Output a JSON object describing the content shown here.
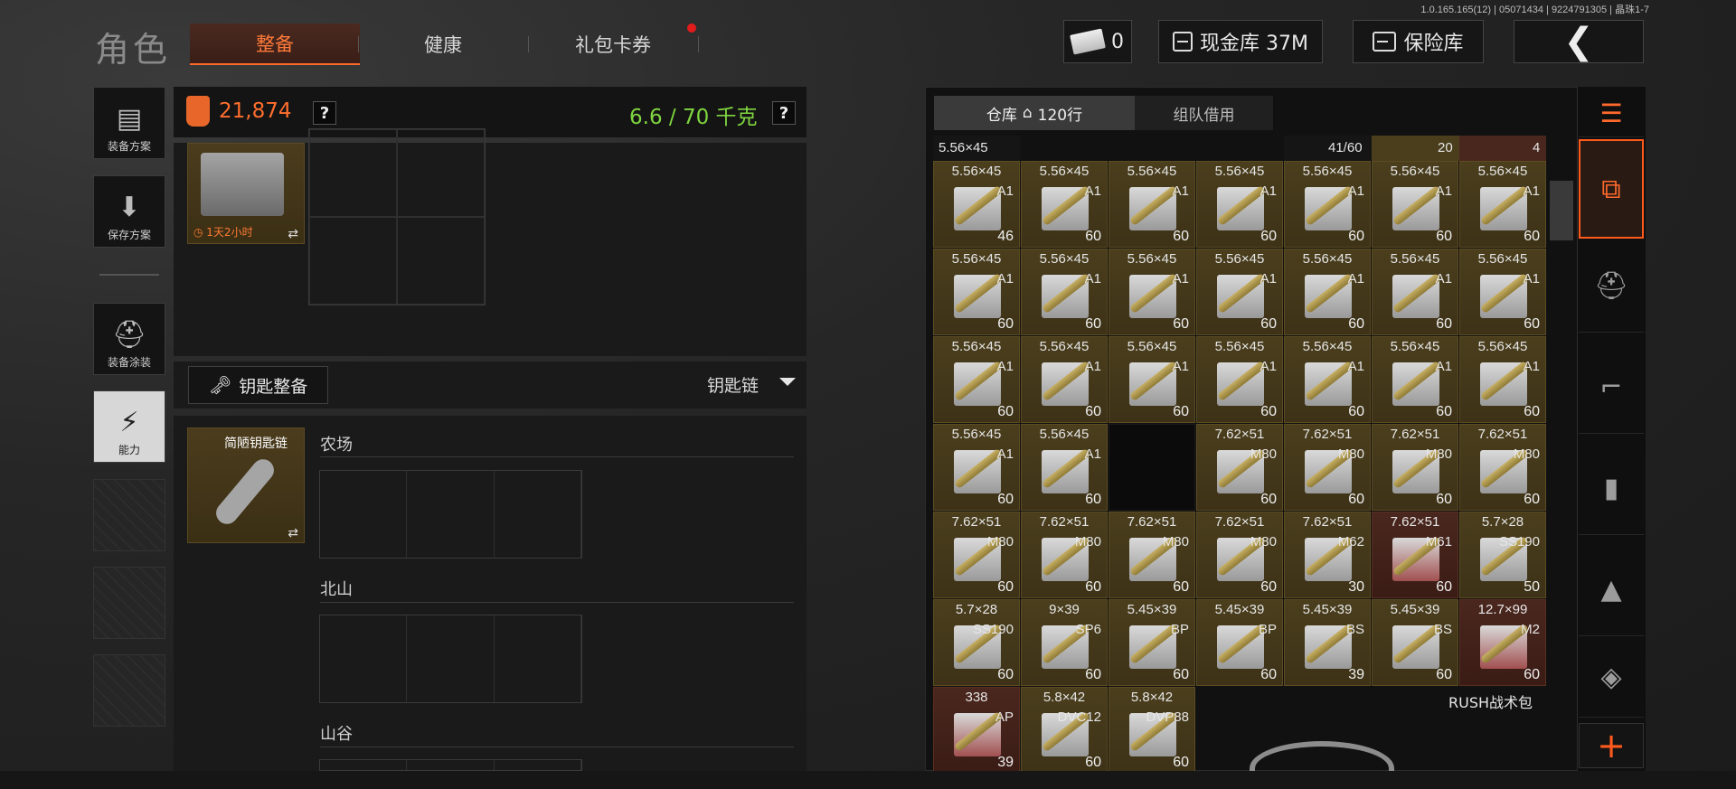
{
  "version": "1.0.165.165(12) | 05071434 | 9224791305 | 晶珠1-7",
  "page_title": "角色",
  "tabs": [
    {
      "label": "整备"
    },
    {
      "label": "健康"
    },
    {
      "label": "礼包卡券"
    }
  ],
  "top": {
    "money": "0",
    "cash": "现金库 37M",
    "safe": "保险库"
  },
  "rail": [
    {
      "label": "装备方案",
      "icon": "vest-icon"
    },
    {
      "label": "保存方案",
      "icon": "download-icon"
    },
    {
      "label": "装备涂装",
      "icon": "helmet-icon"
    },
    {
      "label": "能力",
      "icon": "ability-icon"
    }
  ],
  "stats": {
    "armor_value": "21,874",
    "weight": "6.6 / 70 千克",
    "help": "?"
  },
  "case_item": {
    "timer": "1天2小时",
    "swap": "⇄"
  },
  "keys": {
    "button_label": "钥匙整备",
    "dropdown_label": "钥匙链",
    "item_name": "简陋钥匙链",
    "swap": "⇄",
    "zones": [
      "农场",
      "北山",
      "山谷"
    ]
  },
  "inventory": {
    "tab_warehouse": "仓库",
    "rows": "120行",
    "tab_team": "组队借用",
    "top_strip": [
      {
        "text": "5.56×45",
        "col": 0
      },
      {
        "text": "41/60",
        "col": 4
      },
      {
        "text": "20",
        "col": 5
      },
      {
        "text": "4",
        "col": 6
      }
    ],
    "rush_label": "RUSH战术包",
    "rows_data": [
      [
        {
          "cal": "5.56×45",
          "var": "A1",
          "cnt": "46",
          "bg": "gold"
        },
        {
          "cal": "5.56×45",
          "var": "A1",
          "cnt": "60",
          "bg": "gold"
        },
        {
          "cal": "5.56×45",
          "var": "A1",
          "cnt": "60",
          "bg": "gold"
        },
        {
          "cal": "5.56×45",
          "var": "A1",
          "cnt": "60",
          "bg": "gold"
        },
        {
          "cal": "5.56×45",
          "var": "A1",
          "cnt": "60",
          "bg": "gold"
        },
        {
          "cal": "5.56×45",
          "var": "A1",
          "cnt": "60",
          "bg": "gold"
        },
        {
          "cal": "5.56×45",
          "var": "A1",
          "cnt": "60",
          "bg": "gold"
        }
      ],
      [
        {
          "cal": "5.56×45",
          "var": "A1",
          "cnt": "60",
          "bg": "gold"
        },
        {
          "cal": "5.56×45",
          "var": "A1",
          "cnt": "60",
          "bg": "gold"
        },
        {
          "cal": "5.56×45",
          "var": "A1",
          "cnt": "60",
          "bg": "gold"
        },
        {
          "cal": "5.56×45",
          "var": "A1",
          "cnt": "60",
          "bg": "gold"
        },
        {
          "cal": "5.56×45",
          "var": "A1",
          "cnt": "60",
          "bg": "gold"
        },
        {
          "cal": "5.56×45",
          "var": "A1",
          "cnt": "60",
          "bg": "gold"
        },
        {
          "cal": "5.56×45",
          "var": "A1",
          "cnt": "60",
          "bg": "gold"
        }
      ],
      [
        {
          "cal": "5.56×45",
          "var": "A1",
          "cnt": "60",
          "bg": "gold"
        },
        {
          "cal": "5.56×45",
          "var": "A1",
          "cnt": "60",
          "bg": "gold"
        },
        {
          "cal": "5.56×45",
          "var": "A1",
          "cnt": "60",
          "bg": "gold"
        },
        {
          "cal": "5.56×45",
          "var": "A1",
          "cnt": "60",
          "bg": "gold"
        },
        {
          "cal": "5.56×45",
          "var": "A1",
          "cnt": "60",
          "bg": "gold"
        },
        {
          "cal": "5.56×45",
          "var": "A1",
          "cnt": "60",
          "bg": "gold"
        },
        {
          "cal": "5.56×45",
          "var": "A1",
          "cnt": "60",
          "bg": "gold"
        }
      ],
      [
        {
          "cal": "5.56×45",
          "var": "A1",
          "cnt": "60",
          "bg": "gold"
        },
        {
          "cal": "5.56×45",
          "var": "A1",
          "cnt": "60",
          "bg": "gold"
        },
        {
          "cal": "",
          "var": "",
          "cnt": "",
          "bg": "empty"
        },
        {
          "cal": "7.62×51",
          "var": "M80",
          "cnt": "60",
          "bg": "gold"
        },
        {
          "cal": "7.62×51",
          "var": "M80",
          "cnt": "60",
          "bg": "gold"
        },
        {
          "cal": "7.62×51",
          "var": "M80",
          "cnt": "60",
          "bg": "gold"
        },
        {
          "cal": "7.62×51",
          "var": "M80",
          "cnt": "60",
          "bg": "gold"
        }
      ],
      [
        {
          "cal": "7.62×51",
          "var": "M80",
          "cnt": "60",
          "bg": "gold"
        },
        {
          "cal": "7.62×51",
          "var": "M80",
          "cnt": "60",
          "bg": "gold"
        },
        {
          "cal": "7.62×51",
          "var": "M80",
          "cnt": "60",
          "bg": "gold"
        },
        {
          "cal": "7.62×51",
          "var": "M80",
          "cnt": "60",
          "bg": "gold"
        },
        {
          "cal": "7.62×51",
          "var": "M62",
          "cnt": "30",
          "bg": "gold"
        },
        {
          "cal": "7.62×51",
          "var": "M61",
          "cnt": "60",
          "bg": "red"
        },
        {
          "cal": "5.7×28",
          "var": "SS190",
          "cnt": "50",
          "bg": "gold"
        }
      ],
      [
        {
          "cal": "5.7×28",
          "var": "SS190",
          "cnt": "60",
          "bg": "gold"
        },
        {
          "cal": "9×39",
          "var": "SP6",
          "cnt": "60",
          "bg": "gold"
        },
        {
          "cal": "5.45×39",
          "var": "BP",
          "cnt": "60",
          "bg": "gold"
        },
        {
          "cal": "5.45×39",
          "var": "BP",
          "cnt": "60",
          "bg": "gold"
        },
        {
          "cal": "5.45×39",
          "var": "BS",
          "cnt": "39",
          "bg": "gold"
        },
        {
          "cal": "5.45×39",
          "var": "BS",
          "cnt": "60",
          "bg": "gold"
        },
        {
          "cal": "12.7×99",
          "var": "M2",
          "cnt": "60",
          "bg": "red"
        }
      ],
      [
        {
          "cal": "338",
          "var": "AP",
          "cnt": "39",
          "bg": "red"
        },
        {
          "cal": "5.8×42",
          "var": "DVC12",
          "cnt": "60",
          "bg": "gold"
        },
        {
          "cal": "5.8×42",
          "var": "DVP88",
          "cnt": "60",
          "bg": "gold"
        }
      ]
    ]
  },
  "right_rail": [
    "sort-icon",
    "storage-icon",
    "helmet-icon",
    "rifle-icon",
    "magazine-icon",
    "ammo-icon",
    "gear-icon",
    "add-icon"
  ],
  "colors": {
    "accent": "#ff6a2c",
    "gold_cell": "#4a3e1d",
    "red_cell": "#4a271e",
    "weight_green": "#7fd640"
  }
}
